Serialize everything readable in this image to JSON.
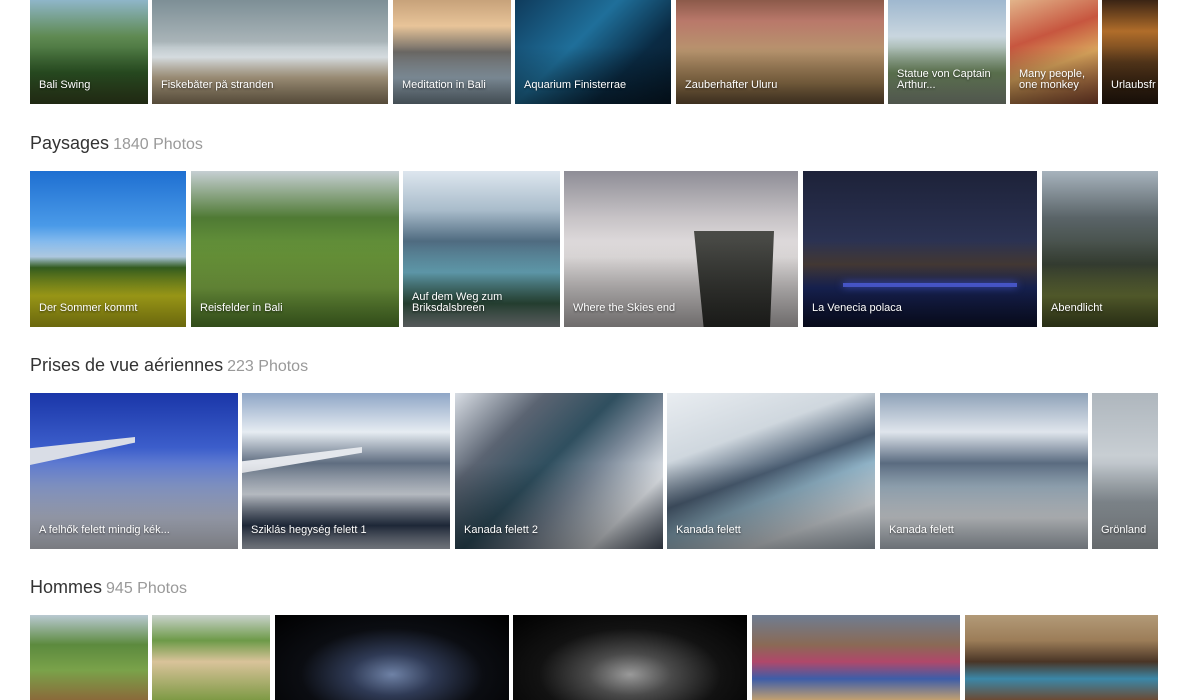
{
  "rows": [
    {
      "id": "top",
      "tiles": [
        {
          "caption": "Bali Swing"
        },
        {
          "caption": "Fiskebåter på stranden"
        },
        {
          "caption": "Meditation in Bali"
        },
        {
          "caption": "Aquarium Finisterrae"
        },
        {
          "caption": "Zauberhafter Uluru"
        },
        {
          "caption": "Statue von Captain Arthur..."
        },
        {
          "caption": "Many people, one monkey"
        },
        {
          "caption": "Urlaubsfr"
        }
      ]
    },
    {
      "id": "paysages",
      "title": "Paysages",
      "count": "1840 Photos",
      "tiles": [
        {
          "caption": "Der Sommer kommt"
        },
        {
          "caption": "Reisfelder in Bali"
        },
        {
          "caption": "Auf dem Weg zum Briksdalsbreen"
        },
        {
          "caption": "Where the Skies end"
        },
        {
          "caption": "La Venecia polaca"
        },
        {
          "caption": "Abendlicht"
        }
      ]
    },
    {
      "id": "aeriennes",
      "title": "Prises de vue aériennes",
      "count": "223 Photos",
      "tiles": [
        {
          "caption": "A felhők felett mindig kék..."
        },
        {
          "caption": "Sziklás hegység felett 1"
        },
        {
          "caption": "Kanada felett 2"
        },
        {
          "caption": "Kanada felett"
        },
        {
          "caption": "Kanada felett"
        },
        {
          "caption": "Grönland"
        }
      ]
    },
    {
      "id": "hommes",
      "title": "Hommes",
      "count": "945 Photos",
      "tiles": [
        {
          "caption": ""
        },
        {
          "caption": ""
        },
        {
          "caption": ""
        },
        {
          "caption": ""
        },
        {
          "caption": ""
        },
        {
          "caption": ""
        }
      ]
    }
  ]
}
